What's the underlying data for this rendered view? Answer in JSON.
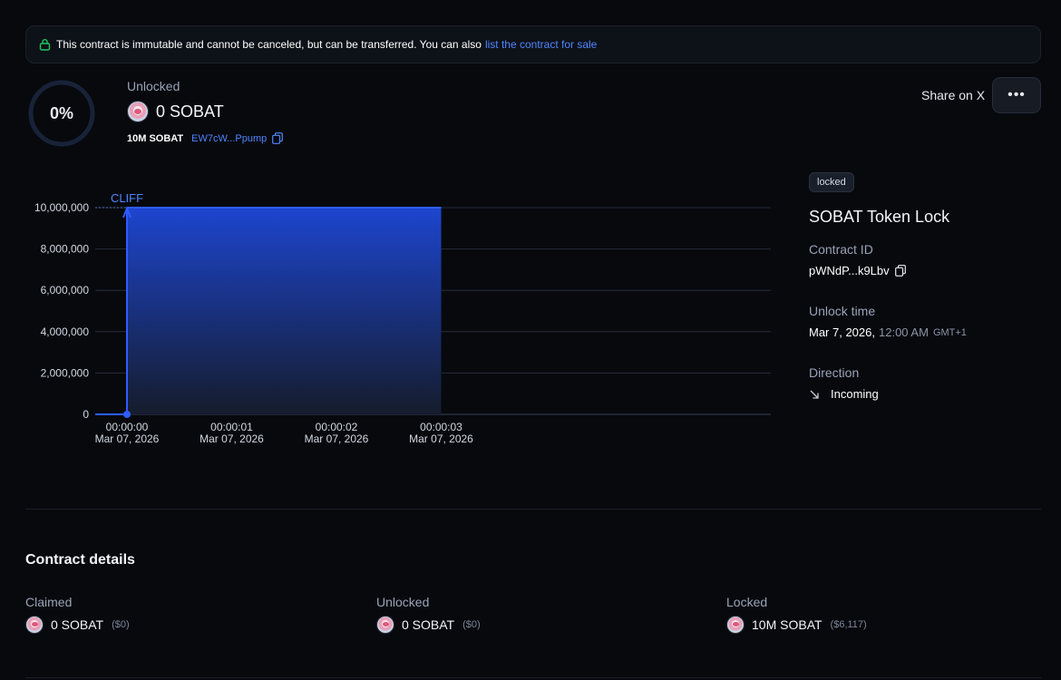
{
  "banner": {
    "text": "This contract is immutable and cannot be canceled, but can be transferred. You can also",
    "link": "list the contract for sale"
  },
  "progress": {
    "percent_label": "0%",
    "fraction": 0
  },
  "summary": {
    "unlocked_label": "Unlocked",
    "unlocked_amount": "0 SOBAT",
    "total": "10M SOBAT",
    "token_address": "EW7cW...Ppump"
  },
  "actions": {
    "share": "Share on X",
    "more": "•••"
  },
  "chart_data": {
    "type": "area",
    "annotation": "CLIFF",
    "y_ticks": [
      "10,000,000",
      "8,000,000",
      "6,000,000",
      "4,000,000",
      "2,000,000",
      "0"
    ],
    "ylim": [
      0,
      10000000
    ],
    "x_ticks": [
      {
        "time": "00:00:00",
        "date": "Mar 07, 2026"
      },
      {
        "time": "00:00:01",
        "date": "Mar 07, 2026"
      },
      {
        "time": "00:00:02",
        "date": "Mar 07, 2026"
      },
      {
        "time": "00:00:03",
        "date": "Mar 07, 2026"
      }
    ],
    "series": [
      {
        "x": [
          "00:00:00",
          "00:00:03"
        ],
        "y": [
          10000000,
          10000000
        ]
      }
    ],
    "grid": true,
    "colors": {
      "line": "#2f5cff",
      "fill_top": "#1d4ed8",
      "grid": "#262c3a"
    }
  },
  "side": {
    "tag": "locked",
    "title": "SOBAT Token Lock",
    "contract_id_label": "Contract ID",
    "contract_id": "pWNdP...k9Lbv",
    "unlock_time_label": "Unlock time",
    "unlock_date": "Mar 7, 2026,",
    "unlock_clock": "12:00 AM",
    "unlock_tz": "GMT+1",
    "direction_label": "Direction",
    "direction": "Incoming"
  },
  "details": {
    "title": "Contract details",
    "columns": [
      {
        "label": "Claimed",
        "amount": "0 SOBAT",
        "usd": "($0)"
      },
      {
        "label": "Unlocked",
        "amount": "0 SOBAT",
        "usd": "($0)"
      },
      {
        "label": "Locked",
        "amount": "10M SOBAT",
        "usd": "($6,117)"
      }
    ]
  }
}
